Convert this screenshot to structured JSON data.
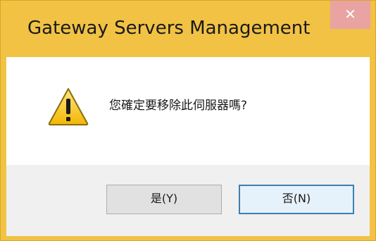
{
  "window": {
    "title": "Gateway Servers Management",
    "close_glyph": "✕"
  },
  "dialog": {
    "icon": "warning-icon",
    "message": "您確定要移除此伺服器嗎?"
  },
  "buttons": {
    "yes_label": "是(Y)",
    "no_label": "否(N)"
  },
  "colors": {
    "frame": "#F1C244",
    "close_button": "#E9A3A3",
    "footer": "#F0F0F0",
    "default_button_border": "#3C7FB1"
  }
}
